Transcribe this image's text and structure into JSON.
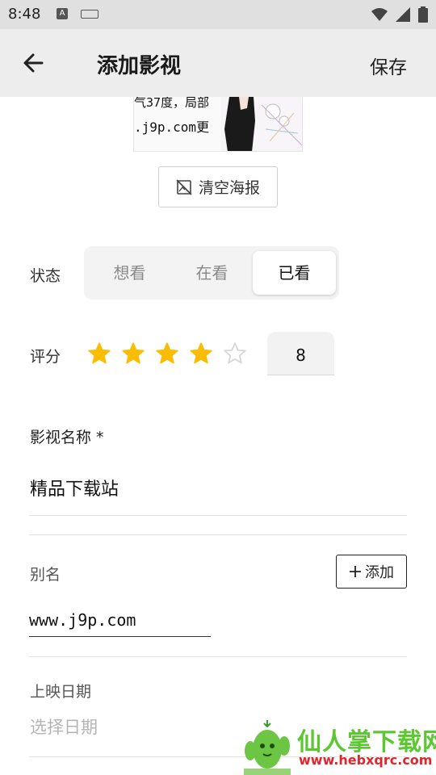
{
  "status_bar": {
    "time": "8:48"
  },
  "app_bar": {
    "title": "添加影视",
    "save_label": "保存"
  },
  "poster": {
    "line1": "气37度，局部",
    "line2": ".j9p.com更",
    "clear_label": "清空海报"
  },
  "status_row": {
    "label": "状态",
    "options": [
      "想看",
      "在看",
      "已看"
    ],
    "selected": "已看"
  },
  "rating": {
    "label": "评分",
    "filled_stars": 4,
    "total_stars": 5,
    "value": "8",
    "star_color": "#fbbc05"
  },
  "name_field": {
    "label": "影视名称 *",
    "value": "精品下载站"
  },
  "alias": {
    "label": "别名",
    "add_label": "添加",
    "value": "www.j9p.com"
  },
  "release_date": {
    "label": "上映日期",
    "placeholder": "选择日期"
  },
  "watermark": {
    "text": "仙人掌下载网",
    "url": "www.hebxqrc.com"
  }
}
